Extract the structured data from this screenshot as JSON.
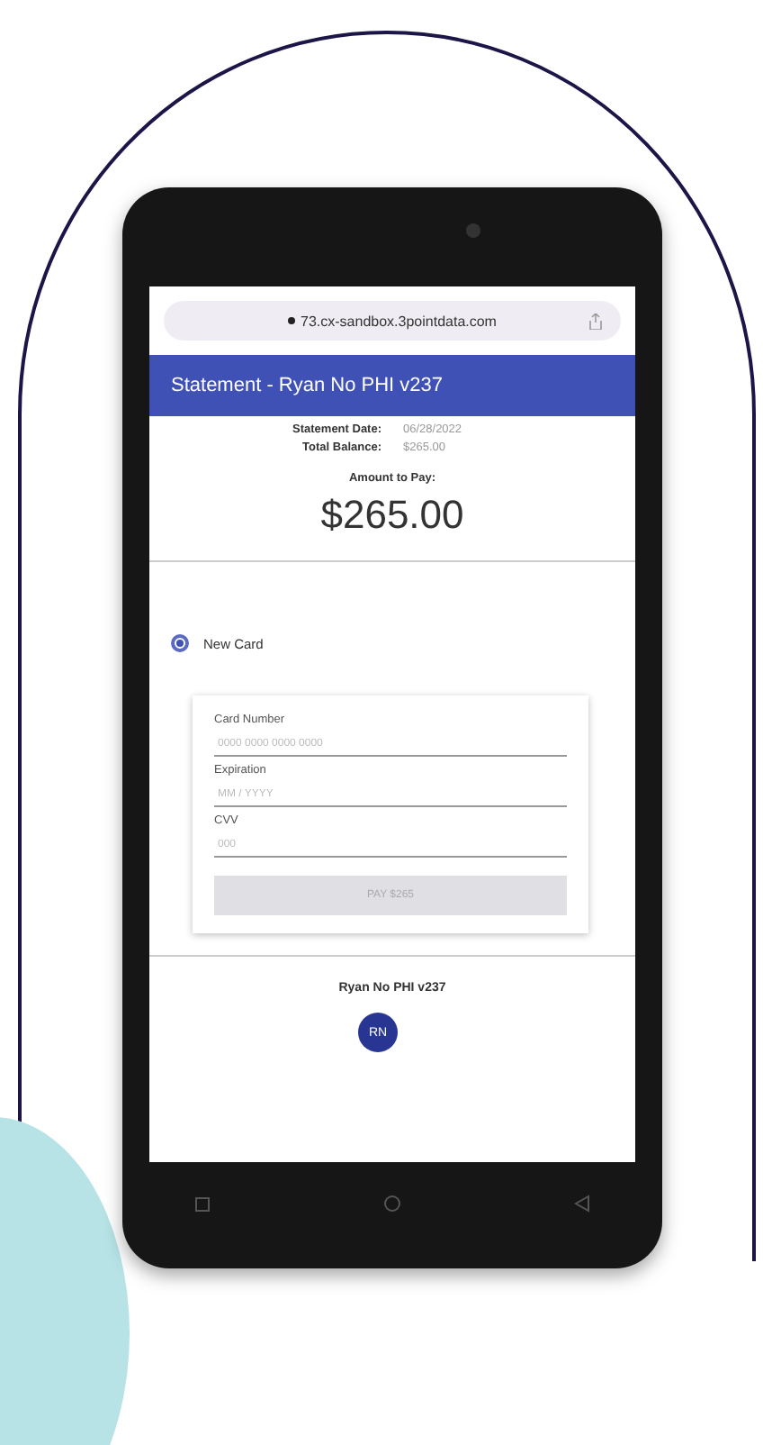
{
  "browser": {
    "url": "73.cx-sandbox.3pointdata.com"
  },
  "header": {
    "title": "Statement - Ryan No PHI v237"
  },
  "summary": [
    {
      "label": "Statement Date:",
      "value": "06/28/2022"
    },
    {
      "label": "Total Balance:",
      "value": "$265.00"
    }
  ],
  "amount": {
    "label": "Amount to Pay:",
    "value": "$265.00"
  },
  "payment_options": [
    {
      "label": "New Card",
      "selected": true
    }
  ],
  "card_form": {
    "fields": [
      {
        "label": "Card Number",
        "placeholder": "0000 0000 0000 0000"
      },
      {
        "label": "Expiration",
        "placeholder": "MM / YYYY"
      },
      {
        "label": "CVV",
        "placeholder": "000"
      }
    ],
    "button": {
      "label": "PAY $265",
      "disabled": true
    }
  },
  "footer": {
    "name": "Ryan No PHI v237",
    "avatar": "RN"
  }
}
